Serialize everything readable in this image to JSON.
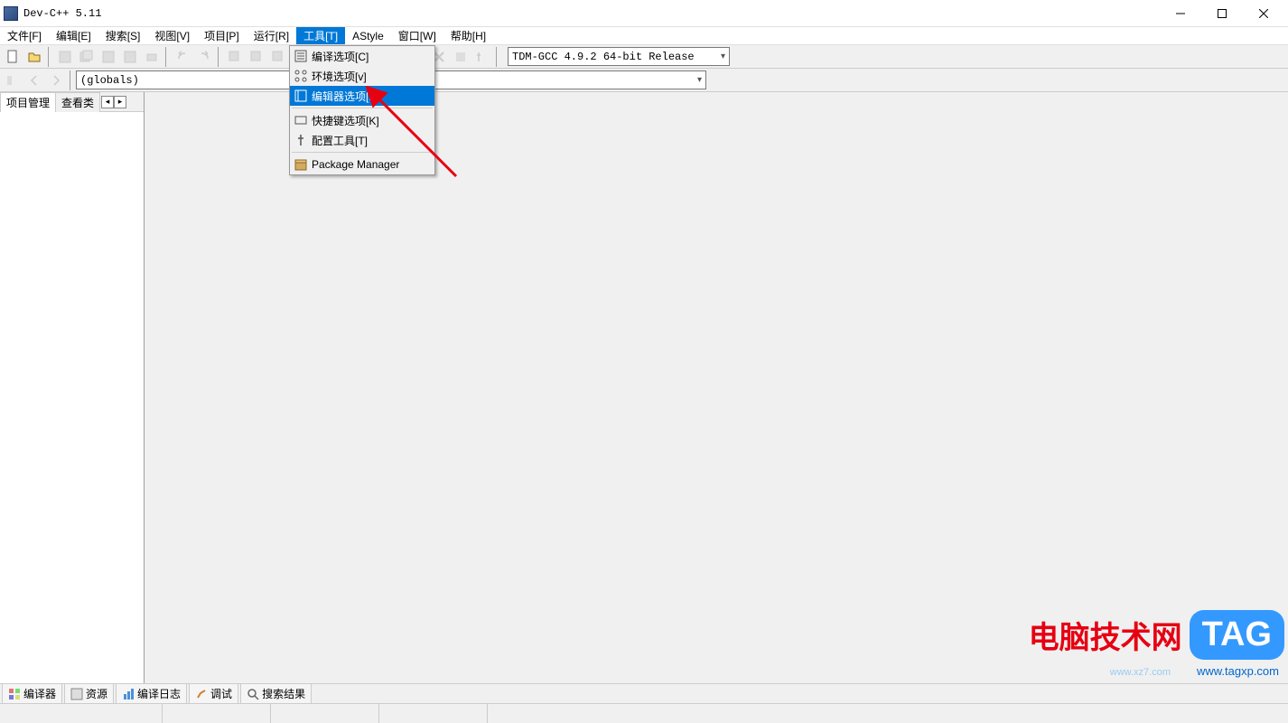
{
  "title": "Dev-C++ 5.11",
  "menu": {
    "file": "文件[F]",
    "edit": "编辑[E]",
    "search": "搜索[S]",
    "view": "视图[V]",
    "project": "项目[P]",
    "run": "运行[R]",
    "tools": "工具[T]",
    "astyle": "AStyle",
    "window": "窗口[W]",
    "help": "帮助[H]"
  },
  "tools_menu": {
    "compile_opts": "编译选项[C]",
    "env_opts": "环境选项[v]",
    "editor_opts": "编辑器选项[E]",
    "shortcut_opts": "快捷键选项[K]",
    "config_tools": "配置工具[T]",
    "pkg_manager": "Package Manager"
  },
  "compiler_combo": "TDM-GCC 4.9.2 64-bit Release",
  "nav_combo": "(globals)",
  "side_tabs": {
    "project": "项目管理",
    "classes": "查看类"
  },
  "bottom_tabs": {
    "compiler": "编译器",
    "resource": "资源",
    "compile_log": "编译日志",
    "debug": "调试",
    "search_result": "搜索结果"
  },
  "watermark": {
    "text": "电脑技术网",
    "badge": "TAG",
    "url": "www.tagxp.com",
    "url2": "www.xz7.com"
  }
}
